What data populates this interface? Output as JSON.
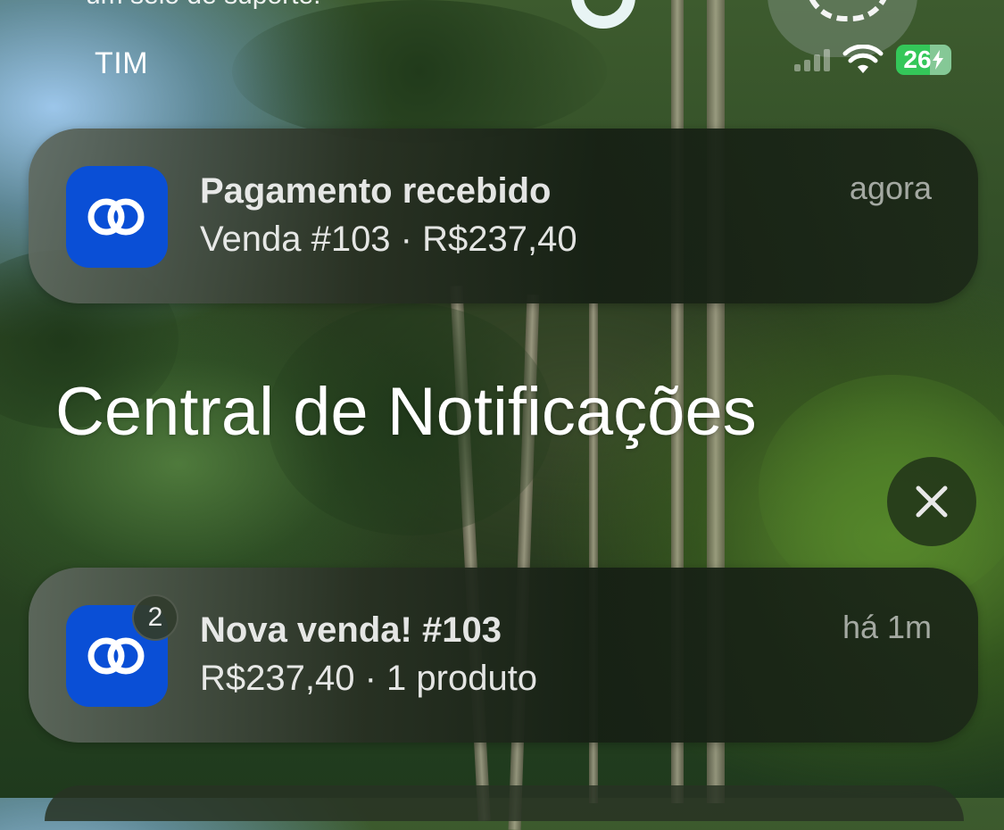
{
  "top_partial_text": "um selo de suporte.",
  "status_bar": {
    "carrier": "TIM",
    "battery": "26"
  },
  "notification_banner": {
    "app_icon": "linked-rings-icon",
    "title": "Pagamento recebido",
    "subtitle": "Venda #103 · R$237,40",
    "time": "agora"
  },
  "notification_center": {
    "header": "Central de Notificações",
    "clear_icon": "close-icon",
    "notifications": [
      {
        "app_icon": "linked-rings-icon",
        "badge": "2",
        "title": "Nova venda! #103",
        "subtitle": "R$237,40 · 1 produto",
        "time": "há 1m"
      }
    ]
  },
  "colors": {
    "app_icon_bg": "#0a4fd6",
    "battery_green": "#34c759"
  }
}
